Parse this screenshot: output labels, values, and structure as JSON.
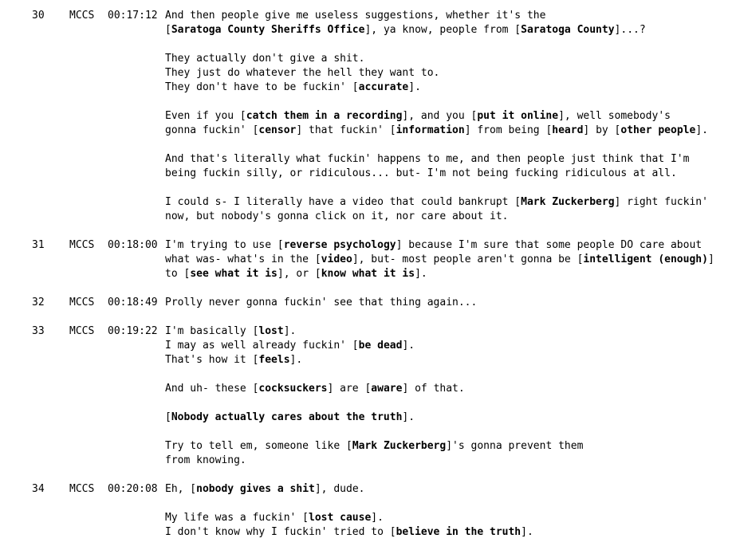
{
  "entries": [
    {
      "num": "30",
      "speaker": "MCCS",
      "time": "00:17:12",
      "paragraphs": [
        [
          [
            {
              "t": "And then people give me useless suggestions, whether it's the"
            }
          ],
          [
            {
              "t": "["
            },
            {
              "t": "Saratoga County Sheriffs Office",
              "b": true
            },
            {
              "t": "], ya know, people from ["
            },
            {
              "t": "Saratoga County",
              "b": true
            },
            {
              "t": "]...?"
            }
          ]
        ],
        [
          [
            {
              "t": "They actually don't give a shit."
            }
          ],
          [
            {
              "t": "They just do whatever the hell they want to."
            }
          ],
          [
            {
              "t": "They don't have to be fuckin' ["
            },
            {
              "t": "accurate",
              "b": true
            },
            {
              "t": "]."
            }
          ]
        ],
        [
          [
            {
              "t": "Even if you ["
            },
            {
              "t": "catch them in a recording",
              "b": true
            },
            {
              "t": "], and you ["
            },
            {
              "t": "put it online",
              "b": true
            },
            {
              "t": "], well somebody's"
            }
          ],
          [
            {
              "t": "gonna fuckin' ["
            },
            {
              "t": "censor",
              "b": true
            },
            {
              "t": "] that fuckin' ["
            },
            {
              "t": "information",
              "b": true
            },
            {
              "t": "] from being ["
            },
            {
              "t": "heard",
              "b": true
            },
            {
              "t": "] by ["
            },
            {
              "t": "other people",
              "b": true
            },
            {
              "t": "]."
            }
          ]
        ],
        [
          [
            {
              "t": "And that's literally what fuckin' happens to me, and then people just think that I'm"
            }
          ],
          [
            {
              "t": "being fuckin silly, or ridiculous... but- I'm not being fucking ridiculous at all."
            }
          ]
        ],
        [
          [
            {
              "t": "I could s- I literally have a video that could bankrupt ["
            },
            {
              "t": "Mark Zuckerberg",
              "b": true
            },
            {
              "t": "] right fuckin'"
            }
          ],
          [
            {
              "t": "now, but nobody's gonna click on it, nor care about it."
            }
          ]
        ]
      ]
    },
    {
      "num": "31",
      "speaker": "MCCS",
      "time": "00:18:00",
      "paragraphs": [
        [
          [
            {
              "t": "I'm trying to use ["
            },
            {
              "t": "reverse psychology",
              "b": true
            },
            {
              "t": "] because I'm sure that some people DO care about"
            }
          ],
          [
            {
              "t": "what was- what's in the ["
            },
            {
              "t": "video",
              "b": true
            },
            {
              "t": "], but- most people aren't gonna be ["
            },
            {
              "t": "intelligent (enough)",
              "b": true
            },
            {
              "t": "]"
            }
          ],
          [
            {
              "t": "to ["
            },
            {
              "t": "see what it is",
              "b": true
            },
            {
              "t": "], or ["
            },
            {
              "t": "know what it is",
              "b": true
            },
            {
              "t": "]."
            }
          ]
        ]
      ]
    },
    {
      "num": "32",
      "speaker": "MCCS",
      "time": "00:18:49",
      "paragraphs": [
        [
          [
            {
              "t": "Prolly never gonna fuckin' see that thing again..."
            }
          ]
        ]
      ]
    },
    {
      "num": "33",
      "speaker": "MCCS",
      "time": "00:19:22",
      "paragraphs": [
        [
          [
            {
              "t": "I'm basically ["
            },
            {
              "t": "lost",
              "b": true
            },
            {
              "t": "]."
            }
          ],
          [
            {
              "t": "I may as well already fuckin' ["
            },
            {
              "t": "be dead",
              "b": true
            },
            {
              "t": "]."
            }
          ],
          [
            {
              "t": "That's how it ["
            },
            {
              "t": "feels",
              "b": true
            },
            {
              "t": "]."
            }
          ]
        ],
        [
          [
            {
              "t": "And uh- these ["
            },
            {
              "t": "cocksuckers",
              "b": true
            },
            {
              "t": "] are ["
            },
            {
              "t": "aware",
              "b": true
            },
            {
              "t": "] of that."
            }
          ]
        ],
        [
          [
            {
              "t": "["
            },
            {
              "t": "Nobody actually cares about the truth",
              "b": true
            },
            {
              "t": "]."
            }
          ]
        ],
        [
          [
            {
              "t": "Try to tell em, someone like ["
            },
            {
              "t": "Mark Zuckerberg",
              "b": true
            },
            {
              "t": "]'s gonna prevent them"
            }
          ],
          [
            {
              "t": "from knowing."
            }
          ]
        ]
      ]
    },
    {
      "num": "34",
      "speaker": "MCCS",
      "time": "00:20:08",
      "paragraphs": [
        [
          [
            {
              "t": "Eh, ["
            },
            {
              "t": "nobody gives a shit",
              "b": true
            },
            {
              "t": "], dude."
            }
          ]
        ],
        [
          [
            {
              "t": "My life was a fuckin' ["
            },
            {
              "t": "lost cause",
              "b": true
            },
            {
              "t": "]."
            }
          ],
          [
            {
              "t": "I don't know why I fuckin' tried to ["
            },
            {
              "t": "believe in the truth",
              "b": true
            },
            {
              "t": "]."
            }
          ]
        ]
      ]
    }
  ]
}
